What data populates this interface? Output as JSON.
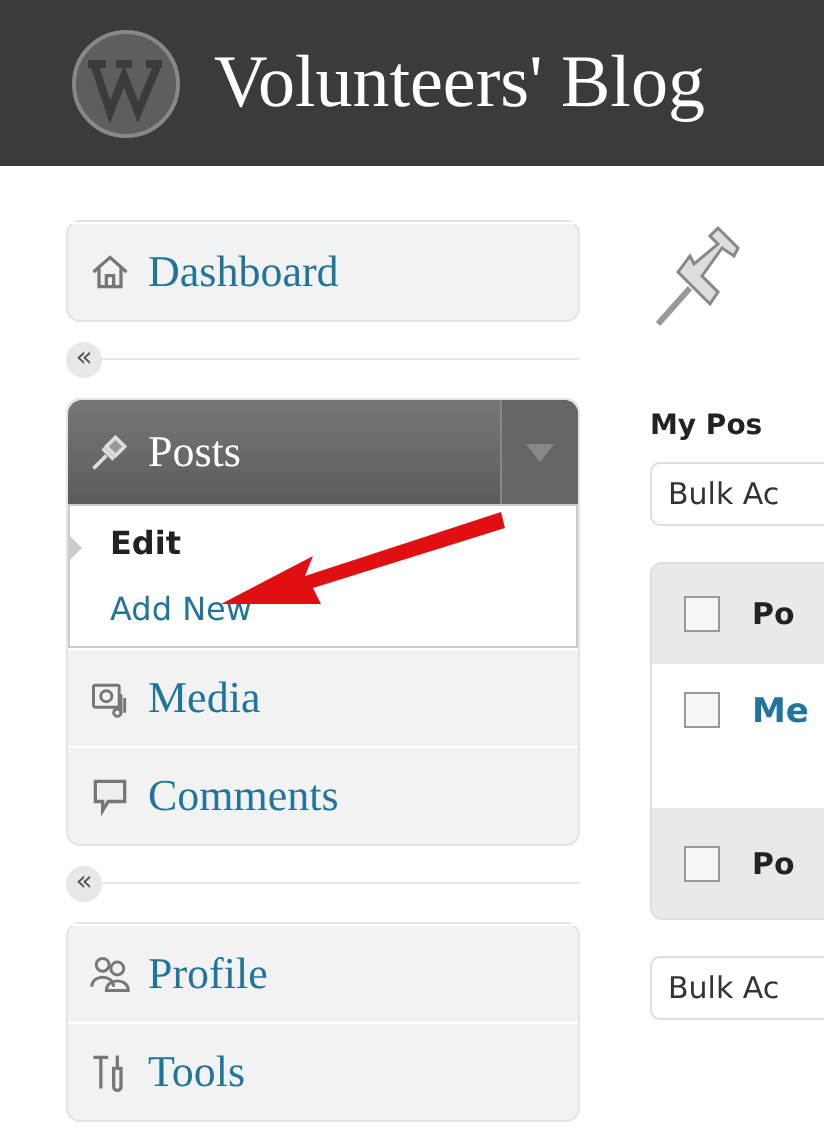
{
  "header": {
    "title": "Volunteers' Blog"
  },
  "sidebar": {
    "groups": [
      {
        "items": [
          {
            "kind": "link",
            "label": "Dashboard",
            "selected": false
          }
        ]
      },
      {
        "items": [
          {
            "kind": "menu",
            "label": "Posts",
            "selected": true,
            "expanded": true,
            "submenu": [
              {
                "label": "Edit",
                "selected": true
              },
              {
                "label": "Add New",
                "selected": false
              }
            ]
          },
          {
            "kind": "link",
            "label": "Media",
            "selected": false
          },
          {
            "kind": "link",
            "label": "Comments",
            "selected": false
          }
        ]
      },
      {
        "items": [
          {
            "kind": "link",
            "label": "Profile",
            "selected": false
          },
          {
            "kind": "link",
            "label": "Tools",
            "selected": false
          }
        ]
      }
    ],
    "collapse_glyph": "«"
  },
  "content": {
    "subheading": "My Pos",
    "bulk_top": "Bulk Ac",
    "table": {
      "header": {
        "label": "Po",
        "checked": false
      },
      "rows": [
        {
          "title": "Me",
          "checked": false
        }
      ],
      "footer": {
        "label": "Po",
        "checked": false
      }
    },
    "bulk_bottom": "Bulk Ac"
  }
}
